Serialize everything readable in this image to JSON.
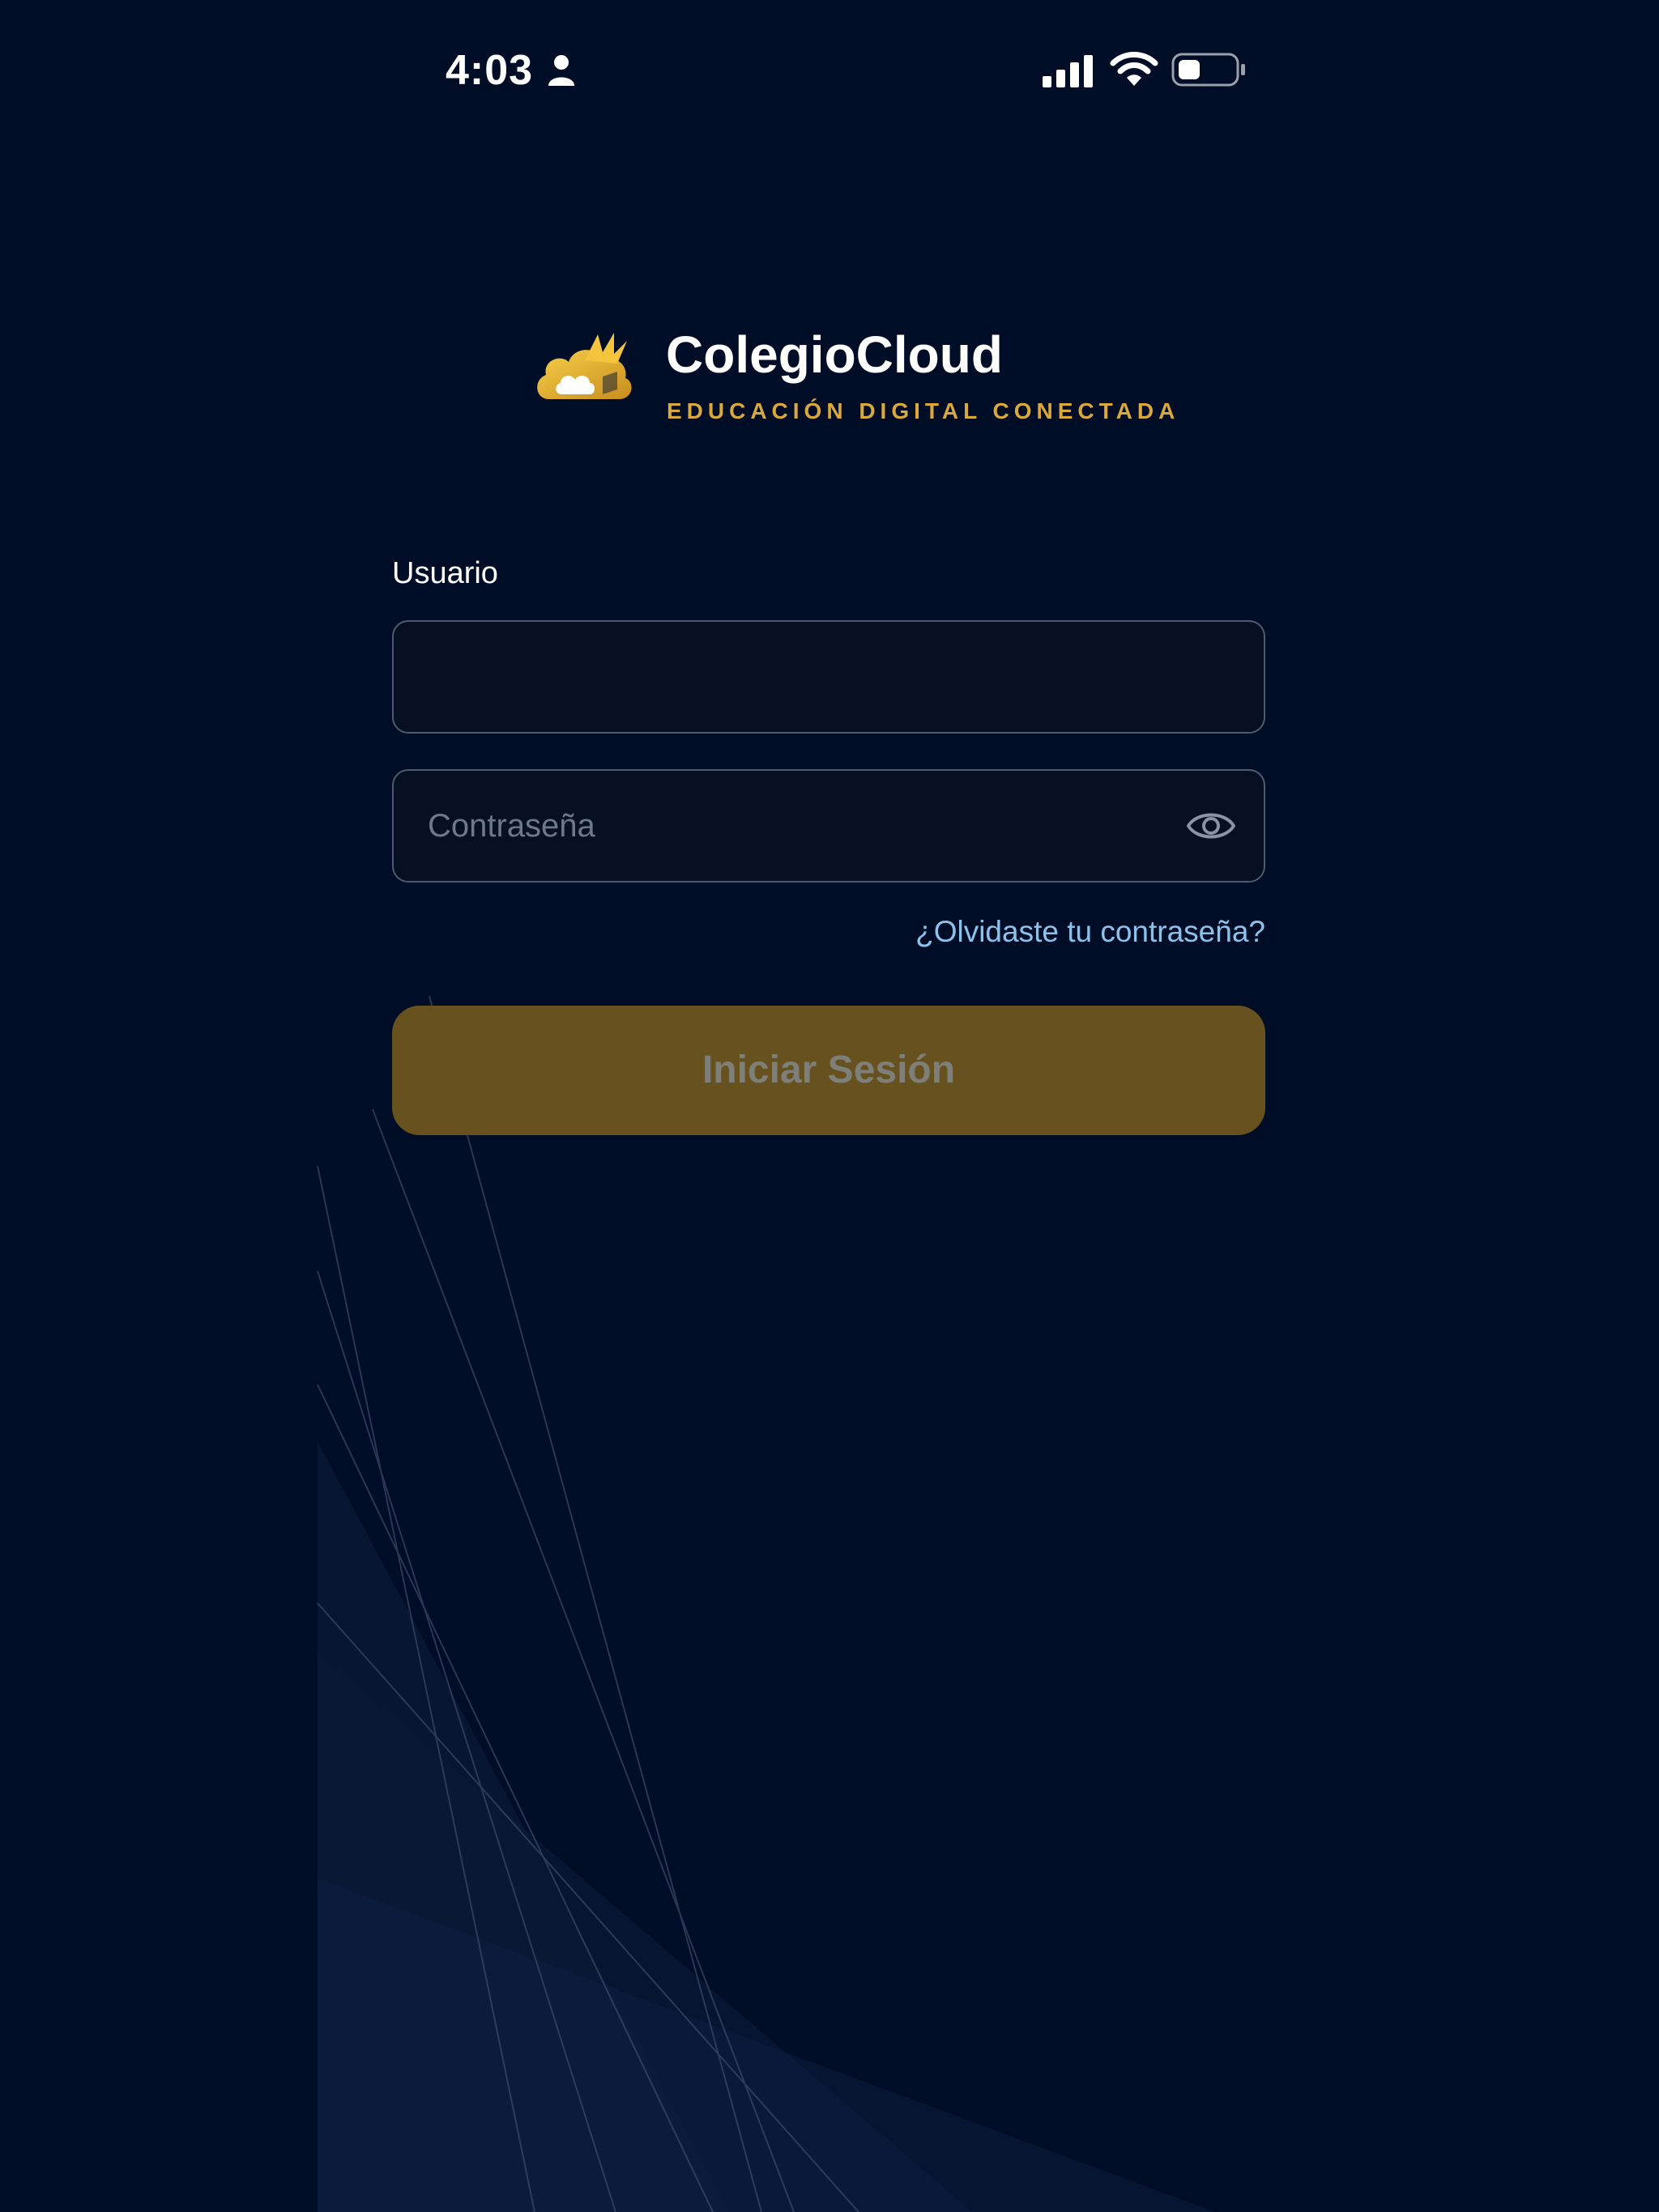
{
  "status_bar": {
    "time": "4:03",
    "icons": [
      "person-icon",
      "signal-icon",
      "wifi-icon",
      "battery-icon"
    ]
  },
  "brand": {
    "name": "ColegioCloud",
    "tagline": "EDUCACIÓN DIGITAL CONECTADA",
    "logo_icon": "cloud-book-logo-icon"
  },
  "form": {
    "user_label": "Usuario",
    "user_value": "",
    "password_placeholder": "Contraseña",
    "password_value": "",
    "password_toggle_icon": "eye-icon",
    "forgot_password": "¿Olvidaste tu contraseña?",
    "submit_label": "Iniciar Sesión",
    "submit_enabled": false
  },
  "colors": {
    "background": "#000d26",
    "accent_gold": "#d9a93c",
    "link": "#8cc3ec",
    "button_disabled": "#66511f"
  }
}
